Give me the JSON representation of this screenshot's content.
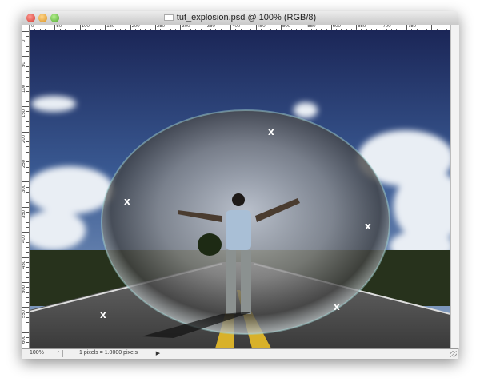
{
  "window": {
    "title": "tut_explosion.psd @ 100% (RGB/8)",
    "traffic_lights": {
      "close": "#e0443e",
      "minimize": "#e8a53a",
      "zoom": "#5fb83d"
    }
  },
  "rulers": {
    "horizontal_labels": [
      "0",
      "50",
      "100",
      "150",
      "200",
      "250",
      "300",
      "350",
      "400",
      "450",
      "500",
      "550",
      "600",
      "650",
      "700",
      "750"
    ],
    "vertical_labels": [
      "0",
      "50",
      "100",
      "150",
      "200",
      "250",
      "300",
      "350",
      "400",
      "450",
      "500",
      "550",
      "600"
    ]
  },
  "canvas": {
    "markers": [
      "x",
      "x",
      "x",
      "x",
      "x"
    ]
  },
  "status_bar": {
    "zoom": "100%",
    "info": "1 pixels = 1.0000 pixels",
    "menu_arrow_icon": "triangle-right-icon"
  }
}
